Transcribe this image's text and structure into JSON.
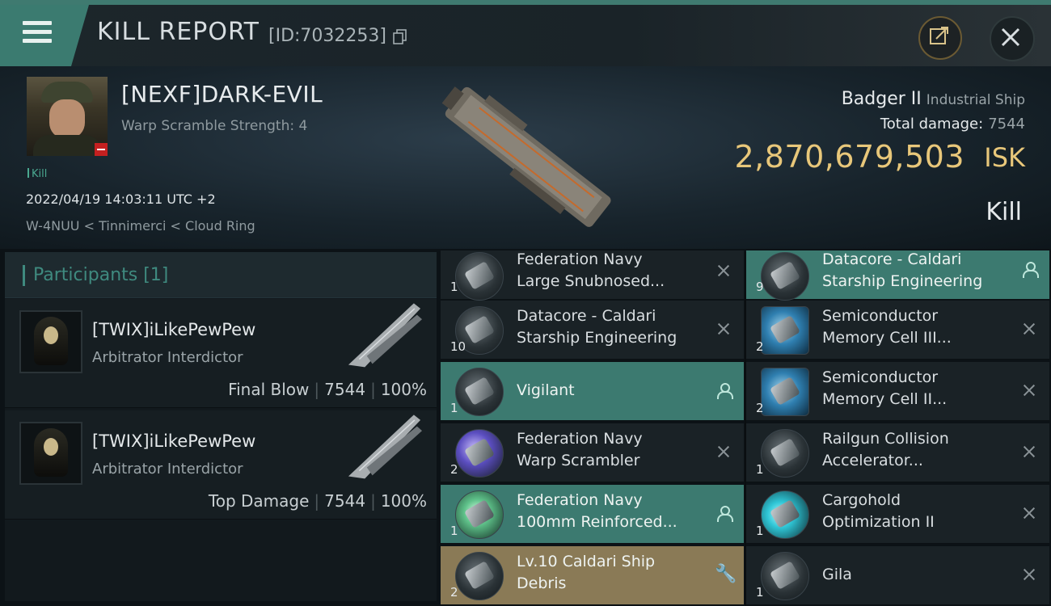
{
  "header": {
    "title": "KILL REPORT",
    "report_id": "[ID:7032253]"
  },
  "victim": {
    "name": "[NEXF]DARK-EVIL",
    "warp_scramble": "Warp Scramble Strength: 4",
    "kill_tag": "Kill",
    "timestamp": "2022/04/19 14:03:11 UTC +2",
    "location": "W-4NUU < Tinnimerci < Cloud Ring",
    "ship_name": "Badger II",
    "ship_class": "Industrial Ship",
    "total_damage_label": "Total damage:",
    "total_damage": "7544",
    "isk_value": "2,870,679,503",
    "isk_unit": "ISK",
    "result": "Kill"
  },
  "participants": {
    "header": "Participants [1]",
    "rows": [
      {
        "name": "[TWIX]iLikePewPew",
        "ship": "Arbitrator Interdictor",
        "label": "Final Blow",
        "damage": "7544",
        "percent": "100%"
      },
      {
        "name": "[TWIX]iLikePewPew",
        "ship": "Arbitrator Interdictor",
        "label": "Top Damage",
        "damage": "7544",
        "percent": "100%"
      }
    ]
  },
  "items": {
    "left": [
      {
        "line1": "Federation Navy",
        "line2": "Large Snubnosed...",
        "qty": "1",
        "status": "destroyed"
      },
      {
        "line1": "Datacore - Caldari",
        "line2": "Starship Engineering",
        "qty": "10",
        "status": "destroyed"
      },
      {
        "line1": "Vigilant",
        "line2": "",
        "qty": "1",
        "status": "dropped"
      },
      {
        "line1": "Federation Navy",
        "line2": "Warp Scrambler",
        "qty": "2",
        "status": "destroyed"
      },
      {
        "line1": "Federation Navy",
        "line2": "100mm Reinforced...",
        "qty": "1",
        "status": "dropped"
      },
      {
        "line1": "Lv.10 Caldari Ship",
        "line2": "Debris",
        "qty": "2",
        "status": "salvage"
      }
    ],
    "right": [
      {
        "line1": "Datacore - Caldari",
        "line2": "Starship Engineering",
        "qty": "9",
        "status": "dropped"
      },
      {
        "line1": "Semiconductor",
        "line2": "Memory Cell III...",
        "qty": "2",
        "status": "destroyed"
      },
      {
        "line1": "Semiconductor",
        "line2": "Memory Cell II...",
        "qty": "2",
        "status": "destroyed"
      },
      {
        "line1": "Railgun Collision",
        "line2": "Accelerator...",
        "qty": "1",
        "status": "destroyed"
      },
      {
        "line1": "Cargohold",
        "line2": "Optimization II",
        "qty": "1",
        "status": "destroyed"
      },
      {
        "line1": "Gila",
        "line2": "",
        "qty": "1",
        "status": "destroyed"
      }
    ]
  },
  "icons": {
    "menu": "menu-icon",
    "copy": "copy-icon",
    "share": "share-icon",
    "close": "close-icon",
    "destroyed": "x-icon",
    "dropped": "person-icon",
    "salvage": "wrench-icon"
  },
  "colors": {
    "accent": "#3b7b70",
    "isk": "#e8c77a",
    "dropped_row": "#3c7a70",
    "salvage_row": "#8a7a56"
  }
}
